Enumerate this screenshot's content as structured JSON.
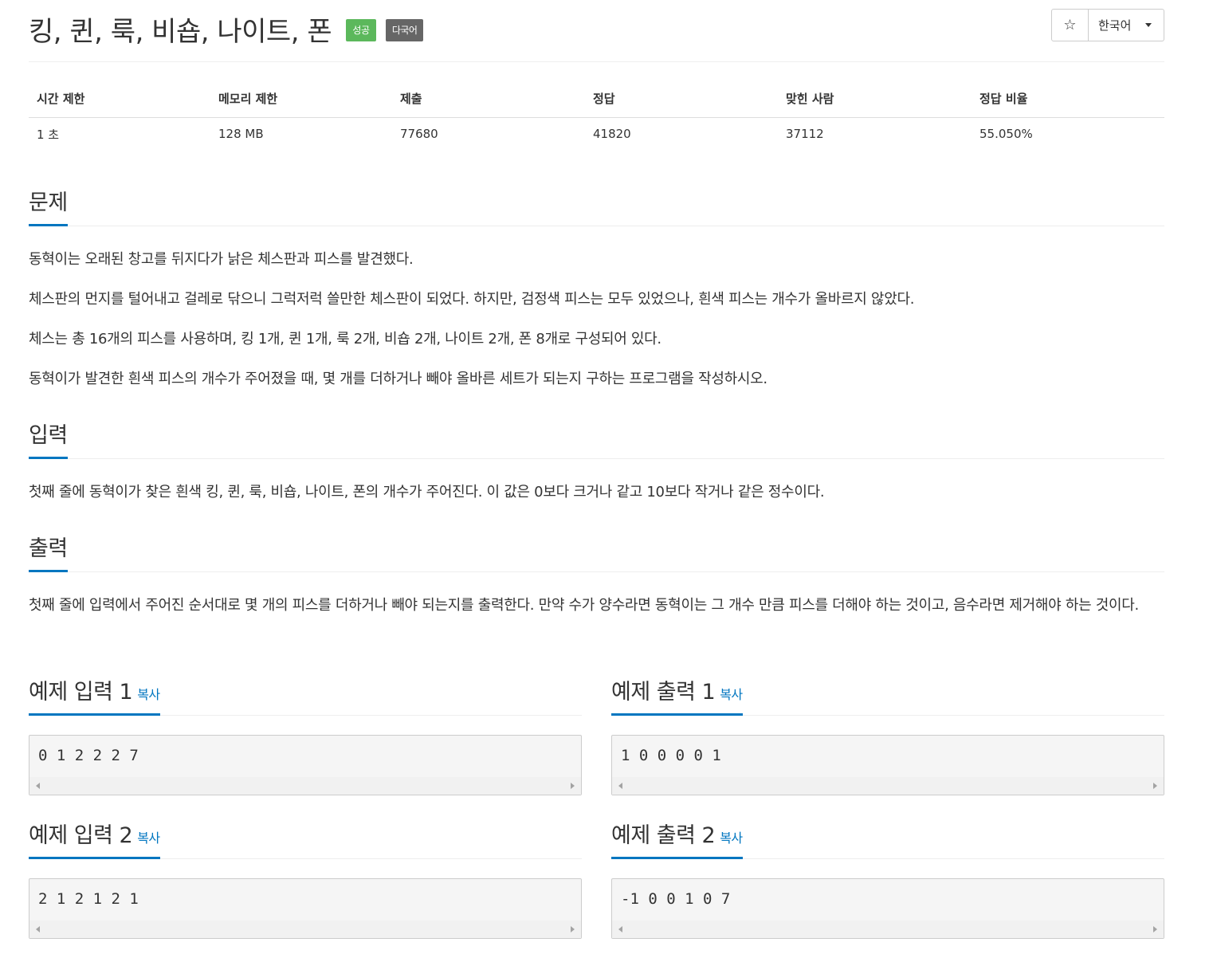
{
  "header": {
    "title": "킹, 퀸, 룩, 비숍, 나이트, 폰",
    "badge_success": "성공",
    "badge_multilang": "다국어",
    "star_icon": "star-outline-icon",
    "language": "한국어"
  },
  "info_table": {
    "headers": [
      "시간 제한",
      "메모리 제한",
      "제출",
      "정답",
      "맞힌 사람",
      "정답 비율"
    ],
    "values": [
      "1 초",
      "128 MB",
      "77680",
      "41820",
      "37112",
      "55.050%"
    ]
  },
  "problem": {
    "heading": "문제",
    "paragraphs": [
      "동혁이는 오래된 창고를 뒤지다가 낡은 체스판과 피스를 발견했다.",
      "체스판의 먼지를 털어내고 걸레로 닦으니 그럭저럭 쓸만한 체스판이 되었다. 하지만, 검정색 피스는 모두 있었으나, 흰색 피스는 개수가 올바르지 않았다.",
      "체스는 총 16개의 피스를 사용하며, 킹 1개, 퀸 1개, 룩 2개, 비숍 2개, 나이트 2개, 폰 8개로 구성되어 있다.",
      "동혁이가 발견한 흰색 피스의 개수가 주어졌을 때, 몇 개를 더하거나 빼야 올바른 세트가 되는지 구하는 프로그램을 작성하시오."
    ]
  },
  "input": {
    "heading": "입력",
    "text": "첫째 줄에 동혁이가 찾은 흰색 킹, 퀸, 룩, 비숍, 나이트, 폰의 개수가 주어진다. 이 값은 0보다 크거나 같고 10보다 작거나 같은 정수이다."
  },
  "output": {
    "heading": "출력",
    "text": "첫째 줄에 입력에서 주어진 순서대로 몇 개의 피스를 더하거나 빼야 되는지를 출력한다. 만약 수가 양수라면 동혁이는 그 개수 만큼 피스를 더해야 하는 것이고, 음수라면 제거해야 하는 것이다."
  },
  "samples": [
    {
      "input_title": "예제 입력 1",
      "input_value": "0 1 2 2 2 7",
      "output_title": "예제 출력 1",
      "output_value": "1 0 0 0 0 1"
    },
    {
      "input_title": "예제 입력 2",
      "input_value": "2 1 2 1 2 1",
      "output_title": "예제 출력 2",
      "output_value": "-1 0 0 1 0 7"
    }
  ],
  "copy_label": "복사"
}
